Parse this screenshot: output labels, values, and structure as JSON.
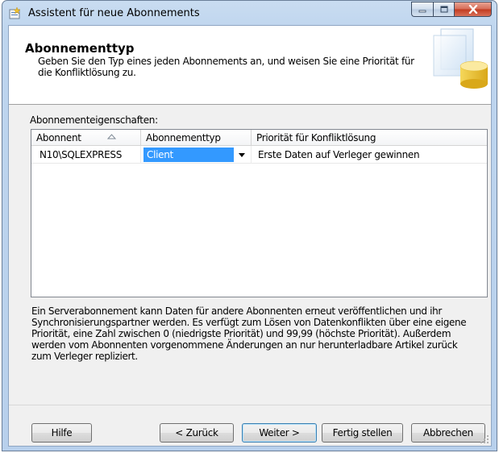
{
  "window": {
    "title": "Assistent für neue Abonnements"
  },
  "header": {
    "title": "Abonnementtyp",
    "description": "Geben Sie den Typ eines jeden Abonnements an, und weisen Sie eine Priorität für die Konfliktlösung zu."
  },
  "properties": {
    "label": "Abonnementeigenschaften:",
    "columns": [
      "Abonnent",
      "Abonnementtyp",
      "Priorität für Konfliktlösung"
    ],
    "sort_column": "Abonnent",
    "rows": [
      {
        "subscriber": "N10\\SQLEXPRESS",
        "type": "Client",
        "priority": "Erste Daten auf Verleger gewinnen"
      }
    ]
  },
  "info_text": "Ein Serverabonnement kann Daten für andere Abonnenten erneut veröffentlichen und ihr Synchronisierungspartner werden. Es verfügt zum Lösen von Datenkonflikten über eine eigene Priorität, eine Zahl zwischen 0 (niedrigste Priorität) und 99,99 (höchste Priorität). Außerdem werden vom Abonnenten vorgenommene Änderungen an nur herunterladbare Artikel zurück zum Verleger repliziert.",
  "buttons": {
    "help": "Hilfe",
    "back": "< Zurück",
    "next": "Weiter >",
    "finish": "Fertig stellen",
    "cancel": "Abbrechen"
  },
  "colors": {
    "selection": "#3399ff",
    "close_button": "#c13a1f"
  },
  "icons": [
    "wizard-app-icon",
    "minimize-icon",
    "maximize-icon",
    "close-icon",
    "sort-ascending-icon",
    "dropdown-arrow-icon",
    "database-wizard-icon",
    "size-grip-icon"
  ]
}
